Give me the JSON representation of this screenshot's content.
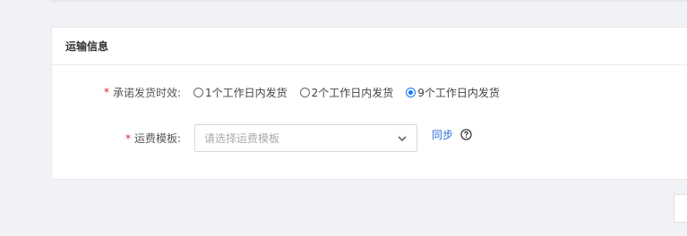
{
  "section": {
    "title": "运输信息"
  },
  "fields": {
    "ship_time": {
      "required_mark": "*",
      "label": "承诺发货时效:",
      "options": [
        {
          "label": "1个工作日内发货",
          "checked": false
        },
        {
          "label": "2个工作日内发货",
          "checked": false
        },
        {
          "label": "9个工作日内发货",
          "checked": true
        }
      ]
    },
    "freight_template": {
      "required_mark": "*",
      "label": "运费模板:",
      "placeholder": "请选择运费模板",
      "sync_link": "同步",
      "help_icon": "question-circle-icon",
      "dropdown_icon": "chevron-down-icon"
    }
  },
  "colors": {
    "accent": "#1677ff",
    "required": "#e02020",
    "link": "#2f6fd6"
  }
}
